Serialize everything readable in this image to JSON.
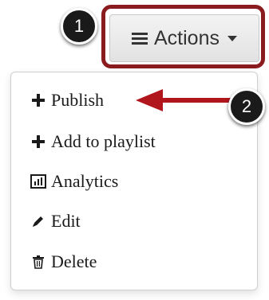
{
  "header": {
    "actions_label": "Actions",
    "actions_icon": "list-icon",
    "caret_icon": "caret-down-icon",
    "highlight_color": "#8a1b1e"
  },
  "callouts": [
    {
      "number": "1"
    },
    {
      "number": "2"
    }
  ],
  "menu": {
    "items": [
      {
        "label": "Publish",
        "icon": "plus-icon"
      },
      {
        "label": "Add to playlist",
        "icon": "plus-icon"
      },
      {
        "label": "Analytics",
        "icon": "bar-chart-icon"
      },
      {
        "label": "Edit",
        "icon": "pencil-icon"
      },
      {
        "label": "Delete",
        "icon": "trash-icon"
      }
    ]
  },
  "annotation": {
    "arrow_color": "#b0161c"
  }
}
